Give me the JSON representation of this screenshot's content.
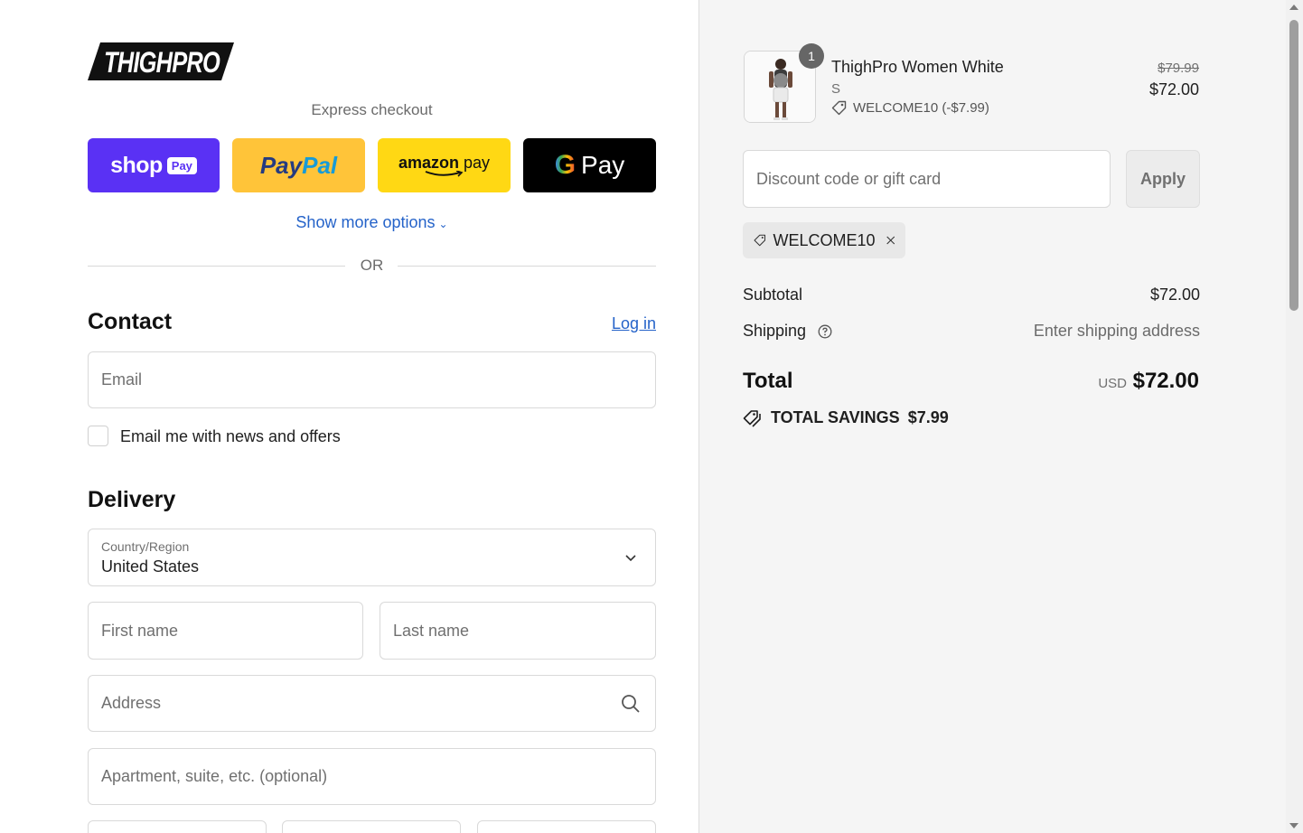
{
  "brand": {
    "logo_text": "THIGHPRO"
  },
  "express": {
    "label": "Express checkout",
    "buttons": {
      "shop_pay": {
        "word": "shop",
        "pill": "Pay",
        "color": "#5a31f4"
      },
      "paypal": {
        "part1": "Pay",
        "part2": "Pal",
        "color": "#ffc439"
      },
      "amazon_pay": {
        "word1": "amazon",
        "word2": "pay",
        "color": "#ffd814"
      },
      "google_pay": {
        "g": "G",
        "word": "Pay",
        "color": "#000000"
      }
    },
    "more_options": "Show more options",
    "or": "OR"
  },
  "contact": {
    "title": "Contact",
    "login": "Log in",
    "email_placeholder": "Email",
    "newsletter_label": "Email me with news and offers"
  },
  "delivery": {
    "title": "Delivery",
    "country_label": "Country/Region",
    "country_value": "United States",
    "first_name_placeholder": "First name",
    "last_name_placeholder": "Last name",
    "address_placeholder": "Address",
    "apartment_placeholder": "Apartment, suite, etc. (optional)"
  },
  "summary": {
    "item": {
      "quantity": "1",
      "name": "ThighPro Women White",
      "variant": "S",
      "discount": "WELCOME10 (-$7.99)",
      "price_old": "$79.99",
      "price_new": "$72.00"
    },
    "discount_placeholder": "Discount code or gift card",
    "apply_label": "Apply",
    "applied_code": "WELCOME10",
    "subtotal_label": "Subtotal",
    "subtotal_value": "$72.00",
    "shipping_label": "Shipping",
    "shipping_value": "Enter shipping address",
    "total_label": "Total",
    "total_currency": "USD",
    "total_value": "$72.00",
    "savings_label": "TOTAL SAVINGS",
    "savings_value": "$7.99"
  },
  "colors": {
    "link": "#2563c9",
    "summary_bg": "#f5f5f5"
  }
}
